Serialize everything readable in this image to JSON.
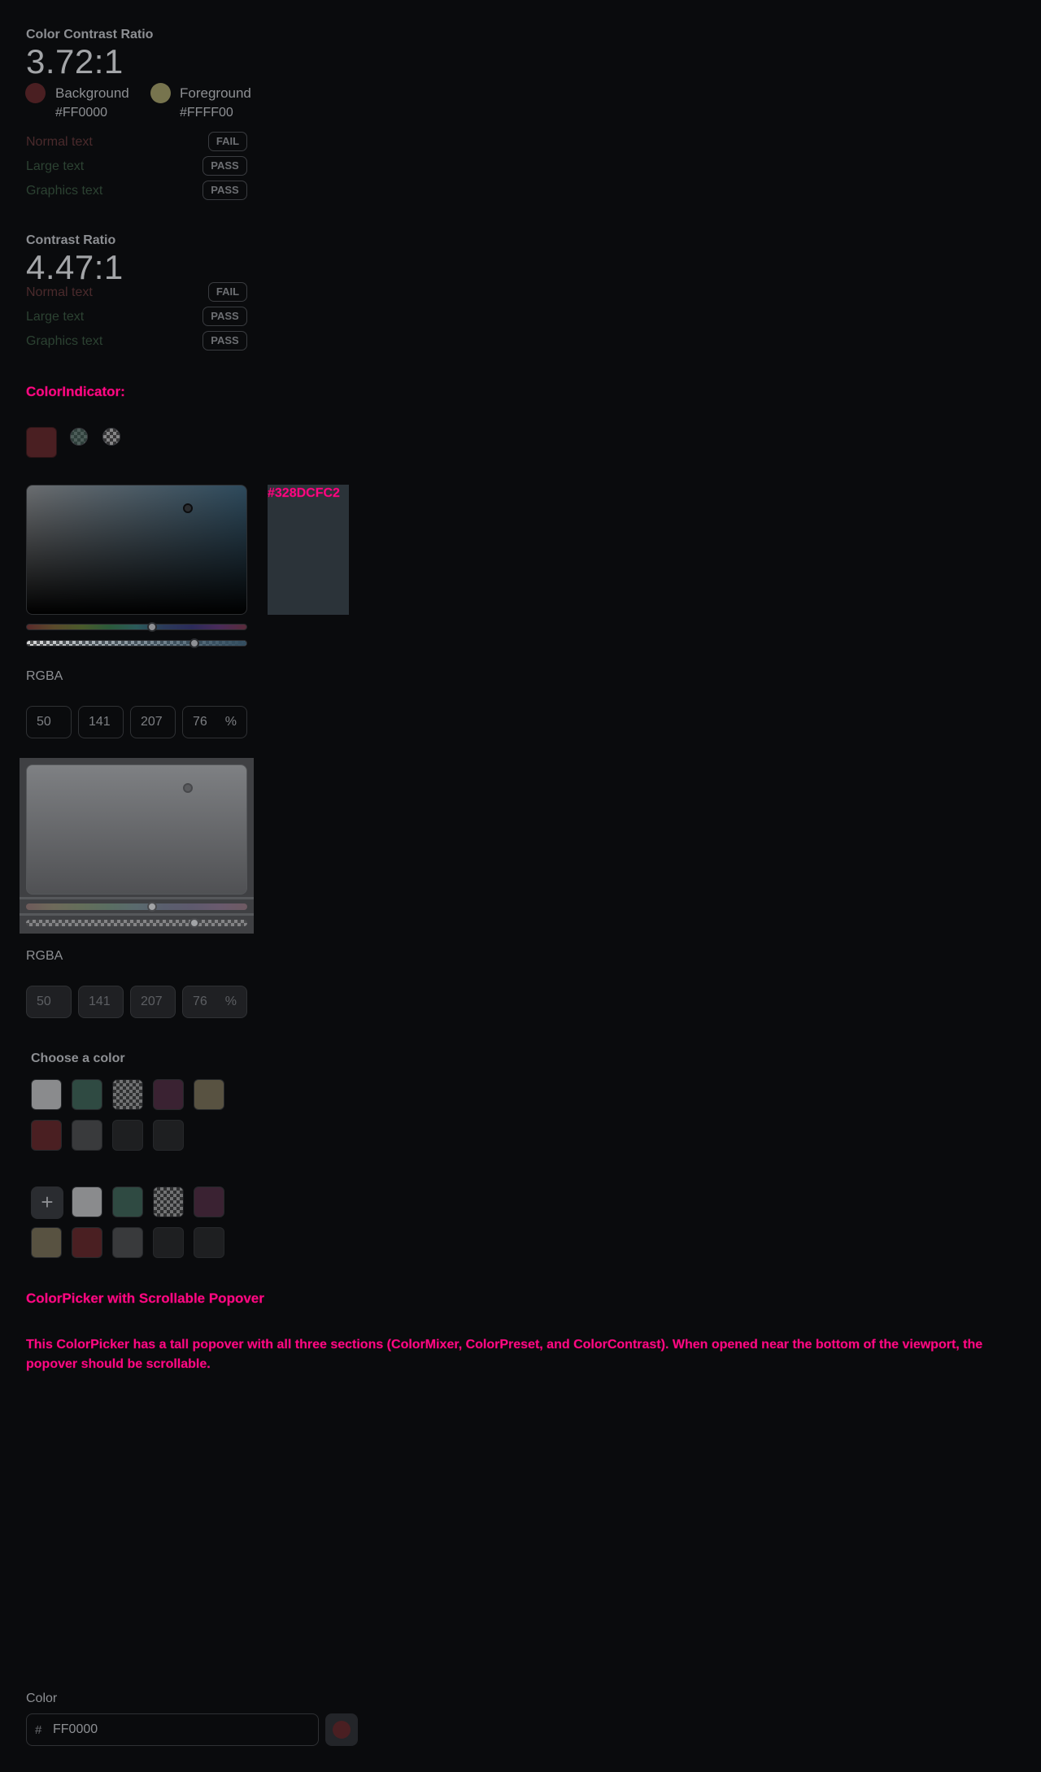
{
  "contrast1": {
    "title": "Color Contrast Ratio",
    "ratio": "3.72:1",
    "background": {
      "label": "Background",
      "hex": "#FF0000",
      "color": "#4a1f22"
    },
    "foreground": {
      "label": "Foreground",
      "hex": "#FFFF00",
      "color": "#77744e"
    },
    "rows": [
      {
        "label": "Normal text",
        "result": "FAIL"
      },
      {
        "label": "Large text",
        "result": "PASS"
      },
      {
        "label": "Graphics text",
        "result": "PASS"
      }
    ]
  },
  "contrast2": {
    "title": "Contrast Ratio",
    "ratio": "4.47:1",
    "rows": [
      {
        "label": "Normal text",
        "result": "FAIL"
      },
      {
        "label": "Large text",
        "result": "PASS"
      },
      {
        "label": "Graphics text",
        "result": "PASS"
      }
    ]
  },
  "indicator": {
    "heading": "ColorIndicator:",
    "main_color": "#4a1f22"
  },
  "mixer1": {
    "hex_label": "#328DCFC2",
    "preview_color": "#2b3339",
    "mode_label": "RGBA",
    "r": "50",
    "g": "141",
    "b": "207",
    "a": "76",
    "unit": "%"
  },
  "mixer2": {
    "mode_label": "RGBA",
    "r": "50",
    "g": "141",
    "b": "207",
    "a": "76",
    "unit": "%"
  },
  "preset1": {
    "title": "Choose a color",
    "swatches": [
      "#8a8b8d",
      "#2f4a42",
      "checker",
      "#3a2232",
      "#585241",
      "#4a1f22",
      "#393a3c",
      "#1e1f21",
      "#1e1f21"
    ]
  },
  "preset2": {
    "add_label": "+",
    "swatches": [
      "#8a8b8d",
      "#2f4a42",
      "checker",
      "#3a2232",
      "#585241",
      "#4a1f22",
      "#393a3c",
      "#1e1f21",
      "#1e1f21",
      "#1e1f21"
    ]
  },
  "scroll_section": {
    "heading": "ColorPicker with Scrollable Popover",
    "description": "This ColorPicker has a tall popover with all three sections (ColorMixer, ColorPreset, and ColorContrast). When opened near the bottom of the viewport, the popover should be scrollable."
  },
  "color_field": {
    "label": "Color",
    "prefix": "#",
    "value": "FF0000",
    "swatch_color": "#4a1f22"
  }
}
